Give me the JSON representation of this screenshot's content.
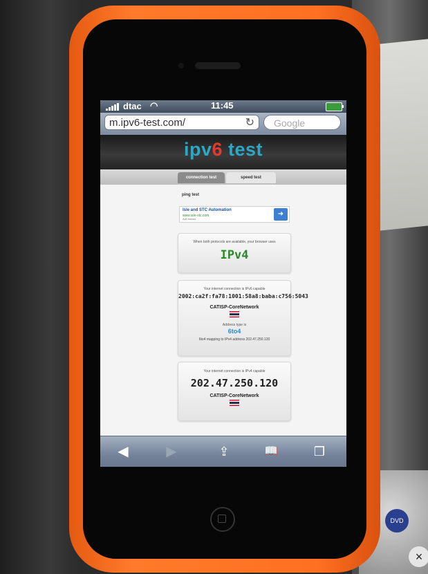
{
  "status": {
    "carrier": "dtac",
    "wifi_icon": "wifi-icon",
    "time": "11:45",
    "battery_icon": "battery-icon"
  },
  "browser": {
    "url": "m.ipv6-test.com/",
    "reload_icon": "↻",
    "search_placeholder": "Google"
  },
  "site": {
    "logo_prefix": "ipv",
    "logo_six": "6",
    "logo_suffix": " test",
    "tabs": [
      {
        "label": "connection test"
      },
      {
        "label": "speed test"
      }
    ],
    "ping_label": "ping test"
  },
  "ad": {
    "title": "Isle and STC Automation",
    "url": "www.isle-stc.com",
    "by": "AdChoices",
    "go_icon": "➜"
  },
  "protocol_card": {
    "description": "When both protocols are available, your browser uses",
    "protocol": "IPv4"
  },
  "ipv6_card": {
    "description": "Your internet connection is IPv6 capable",
    "address": "2002:ca2f:fa78:1001:58a8:baba:c756:5043",
    "isp": "CATISP-CoreNetwork",
    "address_type_label": "Address type is",
    "address_type": "6to4",
    "mapping": "6to4 mapping to IPv4 address 202.47.250.120"
  },
  "ipv4_card": {
    "description": "Your internet connection is IPv4 capable",
    "address": "202.47.250.120",
    "isp": "CATISP-CoreNetwork"
  },
  "toolbar": {
    "back": "◀",
    "forward": "▶",
    "share": "⇪",
    "bookmarks": "📖",
    "pages": "❐"
  },
  "background": {
    "dvd_label": "DVD",
    "x_label": "×"
  },
  "colors": {
    "case": "#ff7022",
    "logo_blue": "#2aa8c4",
    "logo_red": "#e23b2e",
    "ipv4_green": "#2a8a2a",
    "link_blue": "#2a8ad0"
  }
}
